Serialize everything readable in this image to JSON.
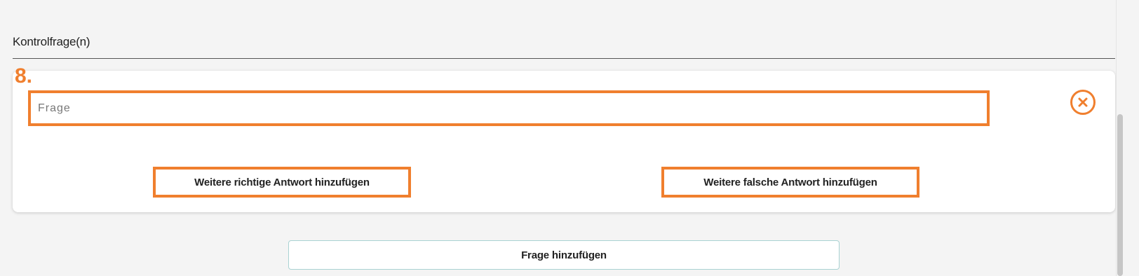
{
  "section": {
    "title": "Kontrolfrage(n)"
  },
  "question": {
    "number": "8.",
    "placeholder": "Frage",
    "value": ""
  },
  "answers": {
    "add_right_label": "Weitere richtige Antwort hinzufügen",
    "add_wrong_label": "Weitere falsche Antwort hinzufügen"
  },
  "footer": {
    "add_question_label": "Frage hinzufügen"
  },
  "icons": {
    "remove": "close-circle-icon"
  },
  "colors": {
    "accent": "#f07f2e",
    "background": "#f4f4f4",
    "card": "#ffffff",
    "add_question_border": "#a9d2d2"
  }
}
